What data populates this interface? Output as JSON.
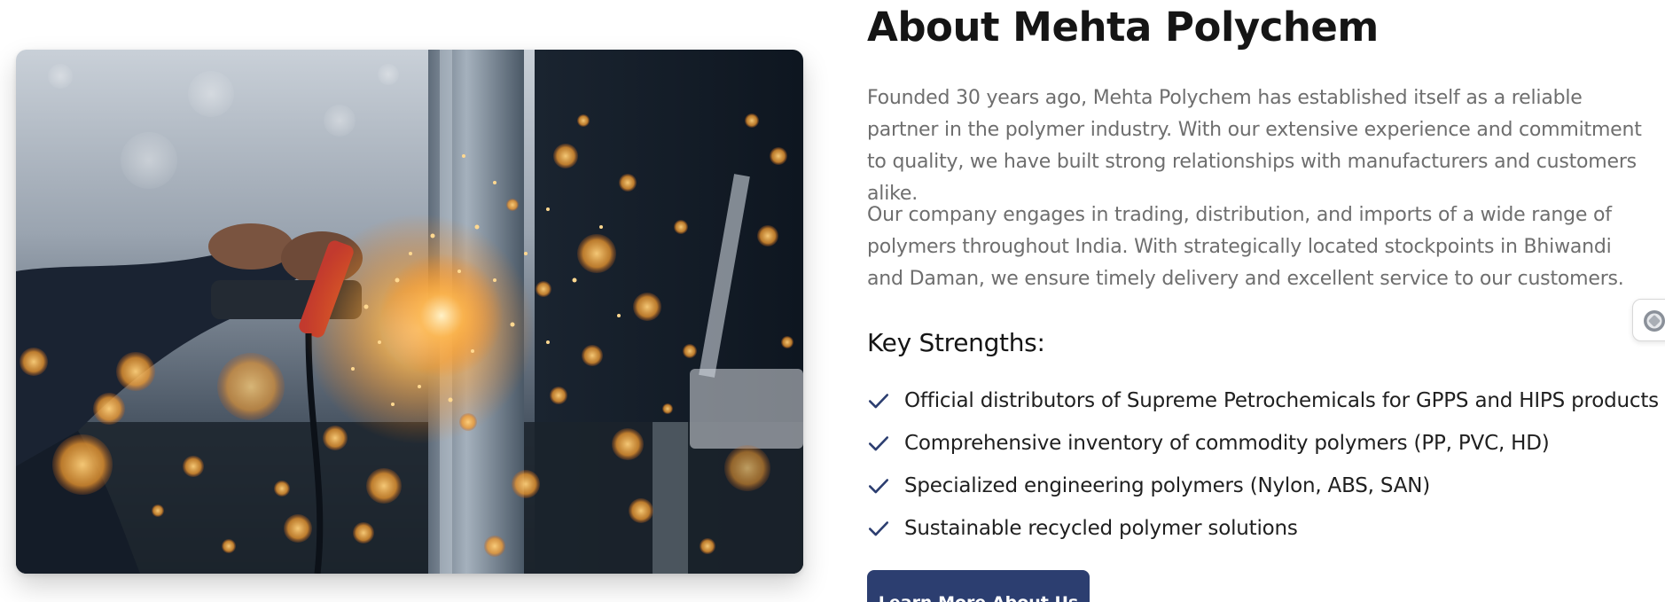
{
  "about": {
    "title": "About Mehta Polychem",
    "paragraphs": [
      "Founded 30 years ago, Mehta Polychem has established itself as a reliable partner in the polymer industry. With our extensive experience and commitment to quality, we have built strong relationships with manufacturers and customers alike.",
      "Our company engages in trading, distribution, and imports of a wide range of polymers throughout India. With strategically located stockpoints in Bhiwandi and Daman, we ensure timely delivery and excellent service to our customers."
    ],
    "strengths_title": "Key Strengths:",
    "strengths": [
      "Official distributors of Supreme Petrochemicals for GPPS and HIPS products",
      "Comprehensive inventory of commodity polymers (PP, PVC, HD)",
      "Specialized engineering polymers (Nylon, ABS, SAN)",
      "Sustainable recycled polymer solutions"
    ],
    "cta_label": "Learn More About Us"
  },
  "icons": {
    "strength_item": "check-icon",
    "side_widget": "chat-widget-icon"
  },
  "colors": {
    "button": "#2c3e70",
    "check": "#2c3e70",
    "body_text": "#6e6e6e",
    "heading": "#151515"
  }
}
